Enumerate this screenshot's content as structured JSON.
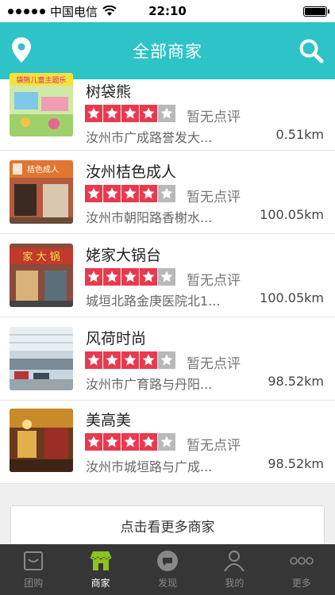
{
  "status_bar": {
    "carrier": "中国电信",
    "time": "22:10"
  },
  "nav": {
    "title": "全部商家",
    "location_icon": "location-pin-icon",
    "search_icon": "search-icon"
  },
  "merchants": [
    {
      "name": "树袋熊",
      "rating": 4,
      "review": "暂无点评",
      "address": "汝州市广成路誉发大...",
      "distance": "0.51km"
    },
    {
      "name": "汝州桔色成人",
      "rating": 4,
      "review": "暂无点评",
      "address": "汝州市朝阳路香榭水...",
      "distance": "100.05km"
    },
    {
      "name": "姥家大锅台",
      "rating": 4,
      "review": "暂无点评",
      "address": "城垣北路金庚医院北1...",
      "distance": "100.05km"
    },
    {
      "name": "风荷时尚",
      "rating": 4,
      "review": "暂无点评",
      "address": "汝州市广育路与丹阳...",
      "distance": "98.52km"
    },
    {
      "name": "美高美",
      "rating": 4,
      "review": "暂无点评",
      "address": "汝州市城垣路与广成...",
      "distance": "98.52km"
    }
  ],
  "thumb_labels": {
    "t0": "袋熊儿童主题乐",
    "t1": "桔色成人",
    "t2": "家 大 锅"
  },
  "more_button": "点击看更多商家",
  "tabs": [
    {
      "label": "团购",
      "icon": "groupbuy-icon",
      "active": false
    },
    {
      "label": "商家",
      "icon": "store-icon",
      "active": true
    },
    {
      "label": "发现",
      "icon": "discover-icon",
      "active": false
    },
    {
      "label": "我的",
      "icon": "profile-icon",
      "active": false
    },
    {
      "label": "更多",
      "icon": "more-icon",
      "active": false
    }
  ],
  "colors": {
    "accent": "#2ec3c6",
    "star_on": "#e83a4f",
    "star_off": "#b9b9b9",
    "tabbar": "#363636",
    "tab_active_icon": "#8fc31f"
  }
}
